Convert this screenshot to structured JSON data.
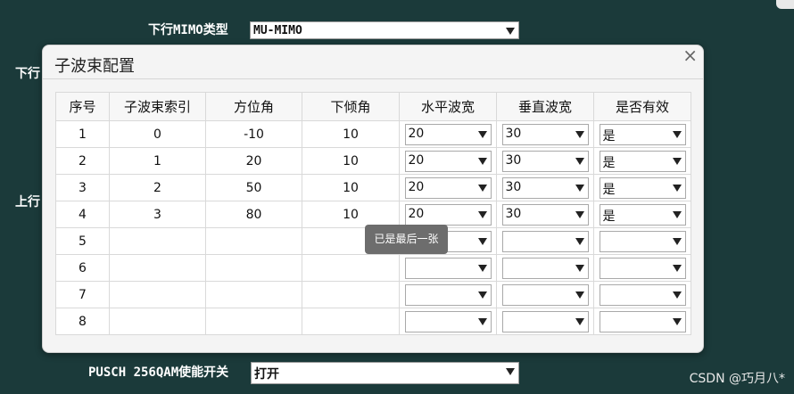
{
  "background": {
    "downlink_mimo_label": "下行MIMO类型",
    "downlink_mimo_value": "MU-MIMO",
    "side_label_1": "下行",
    "side_label_2": "上行",
    "pusch_label": "PUSCH 256QAM使能开关",
    "pusch_value": "打开"
  },
  "dialog": {
    "title": "子波束配置",
    "close_glyph": "×",
    "columns": [
      "序号",
      "子波束索引",
      "方位角",
      "下倾角",
      "水平波宽",
      "垂直波宽",
      "是否有效"
    ],
    "rows": [
      {
        "seq": "1",
        "index": "0",
        "azimuth": "-10",
        "tilt": "10",
        "h_width": "20",
        "v_width": "30",
        "valid": "是"
      },
      {
        "seq": "2",
        "index": "1",
        "azimuth": "20",
        "tilt": "10",
        "h_width": "20",
        "v_width": "30",
        "valid": "是"
      },
      {
        "seq": "3",
        "index": "2",
        "azimuth": "50",
        "tilt": "10",
        "h_width": "20",
        "v_width": "30",
        "valid": "是"
      },
      {
        "seq": "4",
        "index": "3",
        "azimuth": "80",
        "tilt": "10",
        "h_width": "20",
        "v_width": "30",
        "valid": "是"
      },
      {
        "seq": "5",
        "index": "",
        "azimuth": "",
        "tilt": "",
        "h_width": "",
        "v_width": "",
        "valid": ""
      },
      {
        "seq": "6",
        "index": "",
        "azimuth": "",
        "tilt": "",
        "h_width": "",
        "v_width": "",
        "valid": ""
      },
      {
        "seq": "7",
        "index": "",
        "azimuth": "",
        "tilt": "",
        "h_width": "",
        "v_width": "",
        "valid": ""
      },
      {
        "seq": "8",
        "index": "",
        "azimuth": "",
        "tilt": "",
        "h_width": "",
        "v_width": "",
        "valid": ""
      }
    ]
  },
  "tooltip": "已是最后一张",
  "watermark": "CSDN @巧月八​​*",
  "colors": {
    "page_background": "#1b3a3a",
    "dialog_background": "#f4f4f4",
    "tooltip_background": "#6d6d6d"
  }
}
